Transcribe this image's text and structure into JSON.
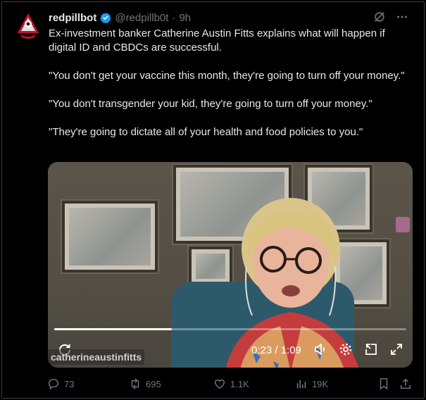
{
  "post": {
    "display_name": "redpillbot",
    "handle": "@redpillb0t",
    "separator": "·",
    "time_ago": "9h",
    "paragraphs": [
      "Ex-investment banker Catherine Austin Fitts explains what will happen if digital ID and CBDCs are successful.",
      "\"You don't get your vaccine this month, they're going to turn off your money.\"",
      "\"You don't transgender your kid, they're going to turn off your money.\"",
      "\"They're going to dictate all of your health and food policies to you.\""
    ]
  },
  "video": {
    "watermark": "catherineaustinfitts",
    "time_display": "0:23 / 1:09",
    "progress": 0.333
  },
  "actions": {
    "replies": "73",
    "reposts": "695",
    "likes": "1.1K",
    "views": "19K"
  },
  "colors": {
    "background": "#000000",
    "verified": "#1d9bf0",
    "muted": "#71767b",
    "avatar_red": "#c8102e"
  },
  "icons": [
    "verified-badge-icon",
    "grok-icon",
    "more-icon",
    "replay-icon",
    "volume-icon",
    "settings-icon",
    "pip-icon",
    "fullscreen-icon",
    "reply-icon",
    "repost-icon",
    "like-icon",
    "views-icon",
    "bookmark-icon",
    "share-icon"
  ]
}
